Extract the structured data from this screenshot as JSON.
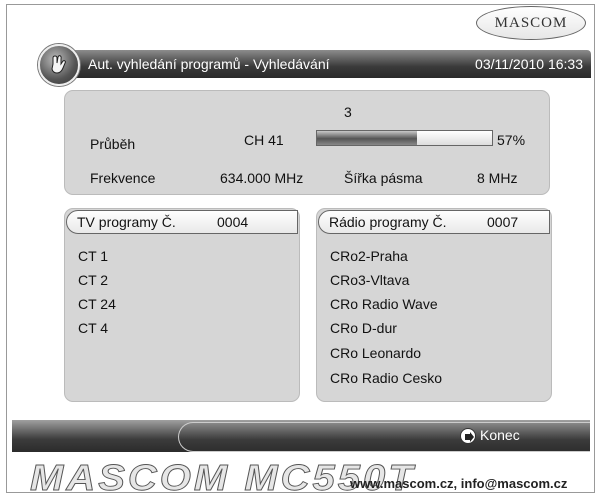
{
  "header": {
    "logo": "MASCOM",
    "title": "Aut. vyhledání programů - Vyhledávání",
    "datetime": "03/11/2010 16:33"
  },
  "scan": {
    "count": "3",
    "progress_label": "Průběh",
    "channel": "CH 41",
    "progress_percent": 57,
    "progress_text": "57%",
    "frequency_label": "Frekvence",
    "frequency_value": "634.000 MHz",
    "bandwidth_label": "Šířka pásma",
    "bandwidth_value": "8 MHz"
  },
  "tv": {
    "header_label": "TV programy Č.",
    "header_count": "0004",
    "items": [
      "CT 1",
      "CT 2",
      "CT 24",
      "CT 4"
    ]
  },
  "radio": {
    "header_label": "Rádio programy Č.",
    "header_count": "0007",
    "items": [
      "CRo2-Praha",
      "CRo3-Vltava",
      "CRo Radio Wave",
      "CRo D-dur",
      "CRo Leonardo",
      "CRo Radio Cesko"
    ]
  },
  "footer": {
    "exit_label": "Konec",
    "brand": "MASCOM MC550T",
    "web": "www.mascom.cz, info@mascom.cz"
  }
}
